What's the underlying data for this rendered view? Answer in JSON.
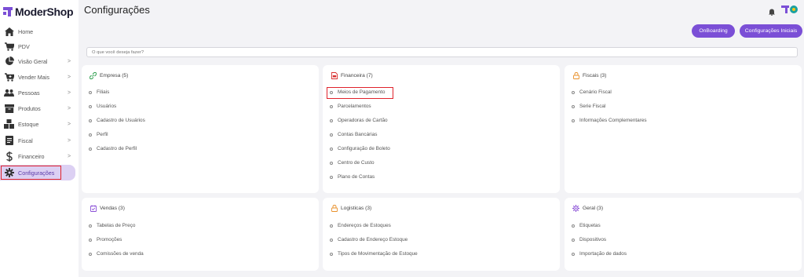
{
  "brand": {
    "name": "ModerShop"
  },
  "sidebar": {
    "items": [
      {
        "label": "Home",
        "icon": "home-icon",
        "has_chevron": false
      },
      {
        "label": "PDV",
        "icon": "cart-icon",
        "has_chevron": false
      },
      {
        "label": "Visão Geral",
        "icon": "pie-chart-icon",
        "has_chevron": true
      },
      {
        "label": "Vender Mais",
        "icon": "cart-plus-icon",
        "has_chevron": true
      },
      {
        "label": "Pessoas",
        "icon": "users-icon",
        "has_chevron": true
      },
      {
        "label": "Produtos",
        "icon": "box-icon",
        "has_chevron": true
      },
      {
        "label": "Estoque",
        "icon": "boxes-icon",
        "has_chevron": true
      },
      {
        "label": "Fiscal",
        "icon": "document-icon",
        "has_chevron": true
      },
      {
        "label": "Financeiro",
        "icon": "dollar-icon",
        "has_chevron": true
      },
      {
        "label": "Configurações",
        "icon": "gear-icon",
        "has_chevron": false,
        "active": true
      }
    ],
    "chevron": ">"
  },
  "header": {
    "title": "Configurações"
  },
  "buttons": {
    "onboarding": "OnBoarding",
    "config_iniciais": "Configurações Iniciais"
  },
  "search": {
    "placeholder": "O que você deseja fazer?"
  },
  "cards": {
    "empresa": {
      "title": "Empresa (5)",
      "icon": "link-icon",
      "items": [
        "Filiais",
        "Usuários",
        "Cadastro de Usuários",
        "Perfil",
        "Cadastro de Perfil"
      ]
    },
    "financeira": {
      "title": "Financeira (7)",
      "icon": "pdf-document-icon",
      "items": [
        "Meios de Pagamento",
        "Parcelamentos",
        "Operadoras de Cartão",
        "Contas Bancárias",
        "Configuração de Boleto",
        "Centro de Custo",
        "Plano de Contas"
      ]
    },
    "fiscais": {
      "title": "Fiscais (3)",
      "icon": "lock-icon",
      "items": [
        "Cenário Fiscal",
        "Serie Fiscal",
        "Informações Complementares"
      ]
    },
    "vendas": {
      "title": "Vendas (3)",
      "icon": "calendar-check-icon",
      "items": [
        "Tabelas de Preço",
        "Promoções",
        "Comissões de venda"
      ]
    },
    "logisticas": {
      "title": "Logisticas (3)",
      "icon": "lock-icon",
      "items": [
        "Endereços de Estoques",
        "Cadastro de Endereço Estoque",
        "Tipos de Movimentação de Estoque"
      ]
    },
    "geral": {
      "title": "Geral (3)",
      "icon": "gear-icon",
      "items": [
        "Etiquetas",
        "Dispositivos",
        "Importação de dados"
      ]
    }
  },
  "colors": {
    "accent": "#7b4fd6",
    "active_bg": "#dcd0f3",
    "highlight": "#e0232c"
  }
}
